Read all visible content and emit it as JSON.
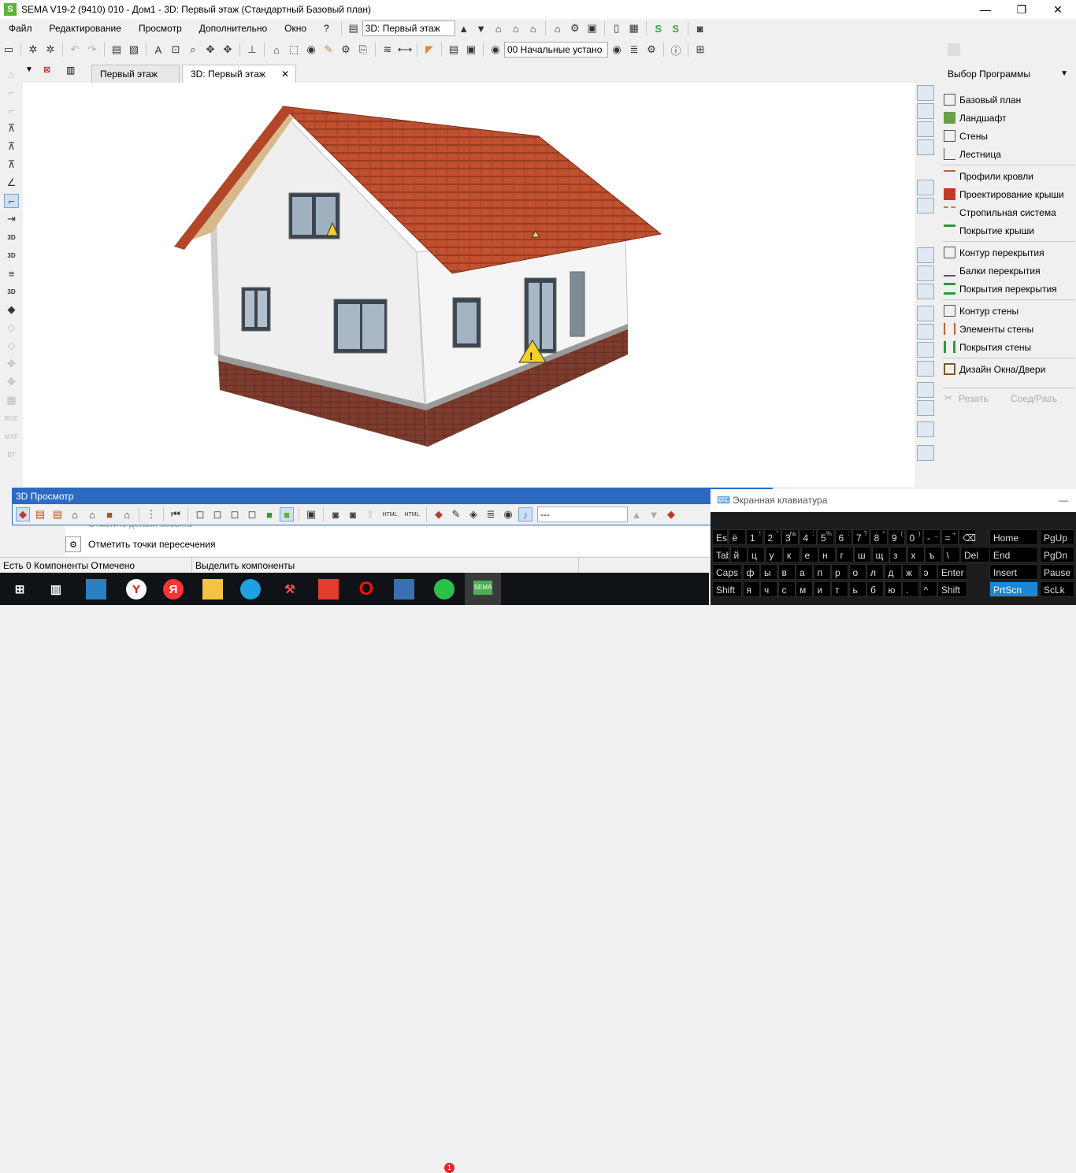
{
  "titlebar": {
    "title": "SEMA V19-2 (9410) 010 - Дом1 - 3D: Первый этаж (Стандартный Базовый план)",
    "logo": "S",
    "minimize": "—",
    "restore": "❐",
    "close": "✕"
  },
  "menu": [
    "Файл",
    "Редактирование",
    "Просмотр",
    "Дополнительно",
    "Окно",
    "?"
  ],
  "toolbar": {
    "view_combo": "3D: Первый этаж",
    "layer_combo": "00 Начальные устано"
  },
  "tabs": [
    {
      "label": "Первый этаж"
    },
    {
      "label": "3D: Первый этаж"
    }
  ],
  "tab_close": "✕",
  "left_tools": {
    "labels": [
      "3D",
      "3D",
      "3D",
      "RGE",
      "MXF",
      "BT"
    ]
  },
  "right_panel": {
    "header": "Выбор Программы",
    "items": [
      "Базовый план",
      "Ландшафт",
      "Стены",
      "Лестница",
      "Профили кровли",
      "Проектирование крыши",
      "Стропильная система",
      "Покрытие крыши",
      "Контур перекрытия",
      "Балки перекрытия",
      "Покрытия перекрытия",
      "Контур стены",
      "Элементы стены",
      "Покрытия стены",
      "Дизайн Окна/Двери"
    ],
    "cut_label": "Резать",
    "join_label": "Соед/Разъ"
  },
  "panel3d": {
    "title": "3D Просмотр",
    "combo": "---",
    "html_label": "HTML"
  },
  "options": {
    "hidden_item": "Отметить детали объекта",
    "intersect": "Отметить точки пересечения"
  },
  "status": {
    "left": "Есть 0 Компоненты Отмечено",
    "middle": "Выделить компоненты"
  },
  "taskbar": {
    "whatsapp_badge": "1",
    "sema_label": "SEMA"
  },
  "osk": {
    "title": "Экранная клавиатура",
    "minimize": "—",
    "row1": [
      "Esc",
      "ё",
      "1",
      "2",
      "3",
      "4",
      "5",
      "6",
      "7",
      "8",
      "9",
      "0",
      "-",
      "=",
      "⌫"
    ],
    "row1_shift": [
      "",
      "",
      "!",
      "\"",
      "№",
      ";",
      "%",
      ":",
      "?",
      "*",
      "(",
      ")",
      "_",
      "+",
      ""
    ],
    "row2": [
      "Tab",
      "й",
      "ц",
      "у",
      "к",
      "е",
      "н",
      "г",
      "ш",
      "щ",
      "з",
      "х",
      "ъ",
      "\\",
      "Del"
    ],
    "row3": [
      "Caps",
      "ф",
      "ы",
      "в",
      "а",
      "п",
      "р",
      "о",
      "л",
      "д",
      "ж",
      "э",
      "Enter"
    ],
    "row4": [
      "Shift",
      "я",
      "ч",
      "с",
      "м",
      "и",
      "т",
      "ь",
      "б",
      "ю",
      ".",
      "^",
      "Shift"
    ],
    "nav": [
      "Home",
      "PgUp",
      "End",
      "PgDn",
      "Insert",
      "Pause",
      "PrtScn",
      "ScLk"
    ]
  },
  "colors": {
    "accent": "#2d6bc2",
    "roof": "#b5452a",
    "brick": "#7a3a2c",
    "wall": "#f2f2f2"
  }
}
